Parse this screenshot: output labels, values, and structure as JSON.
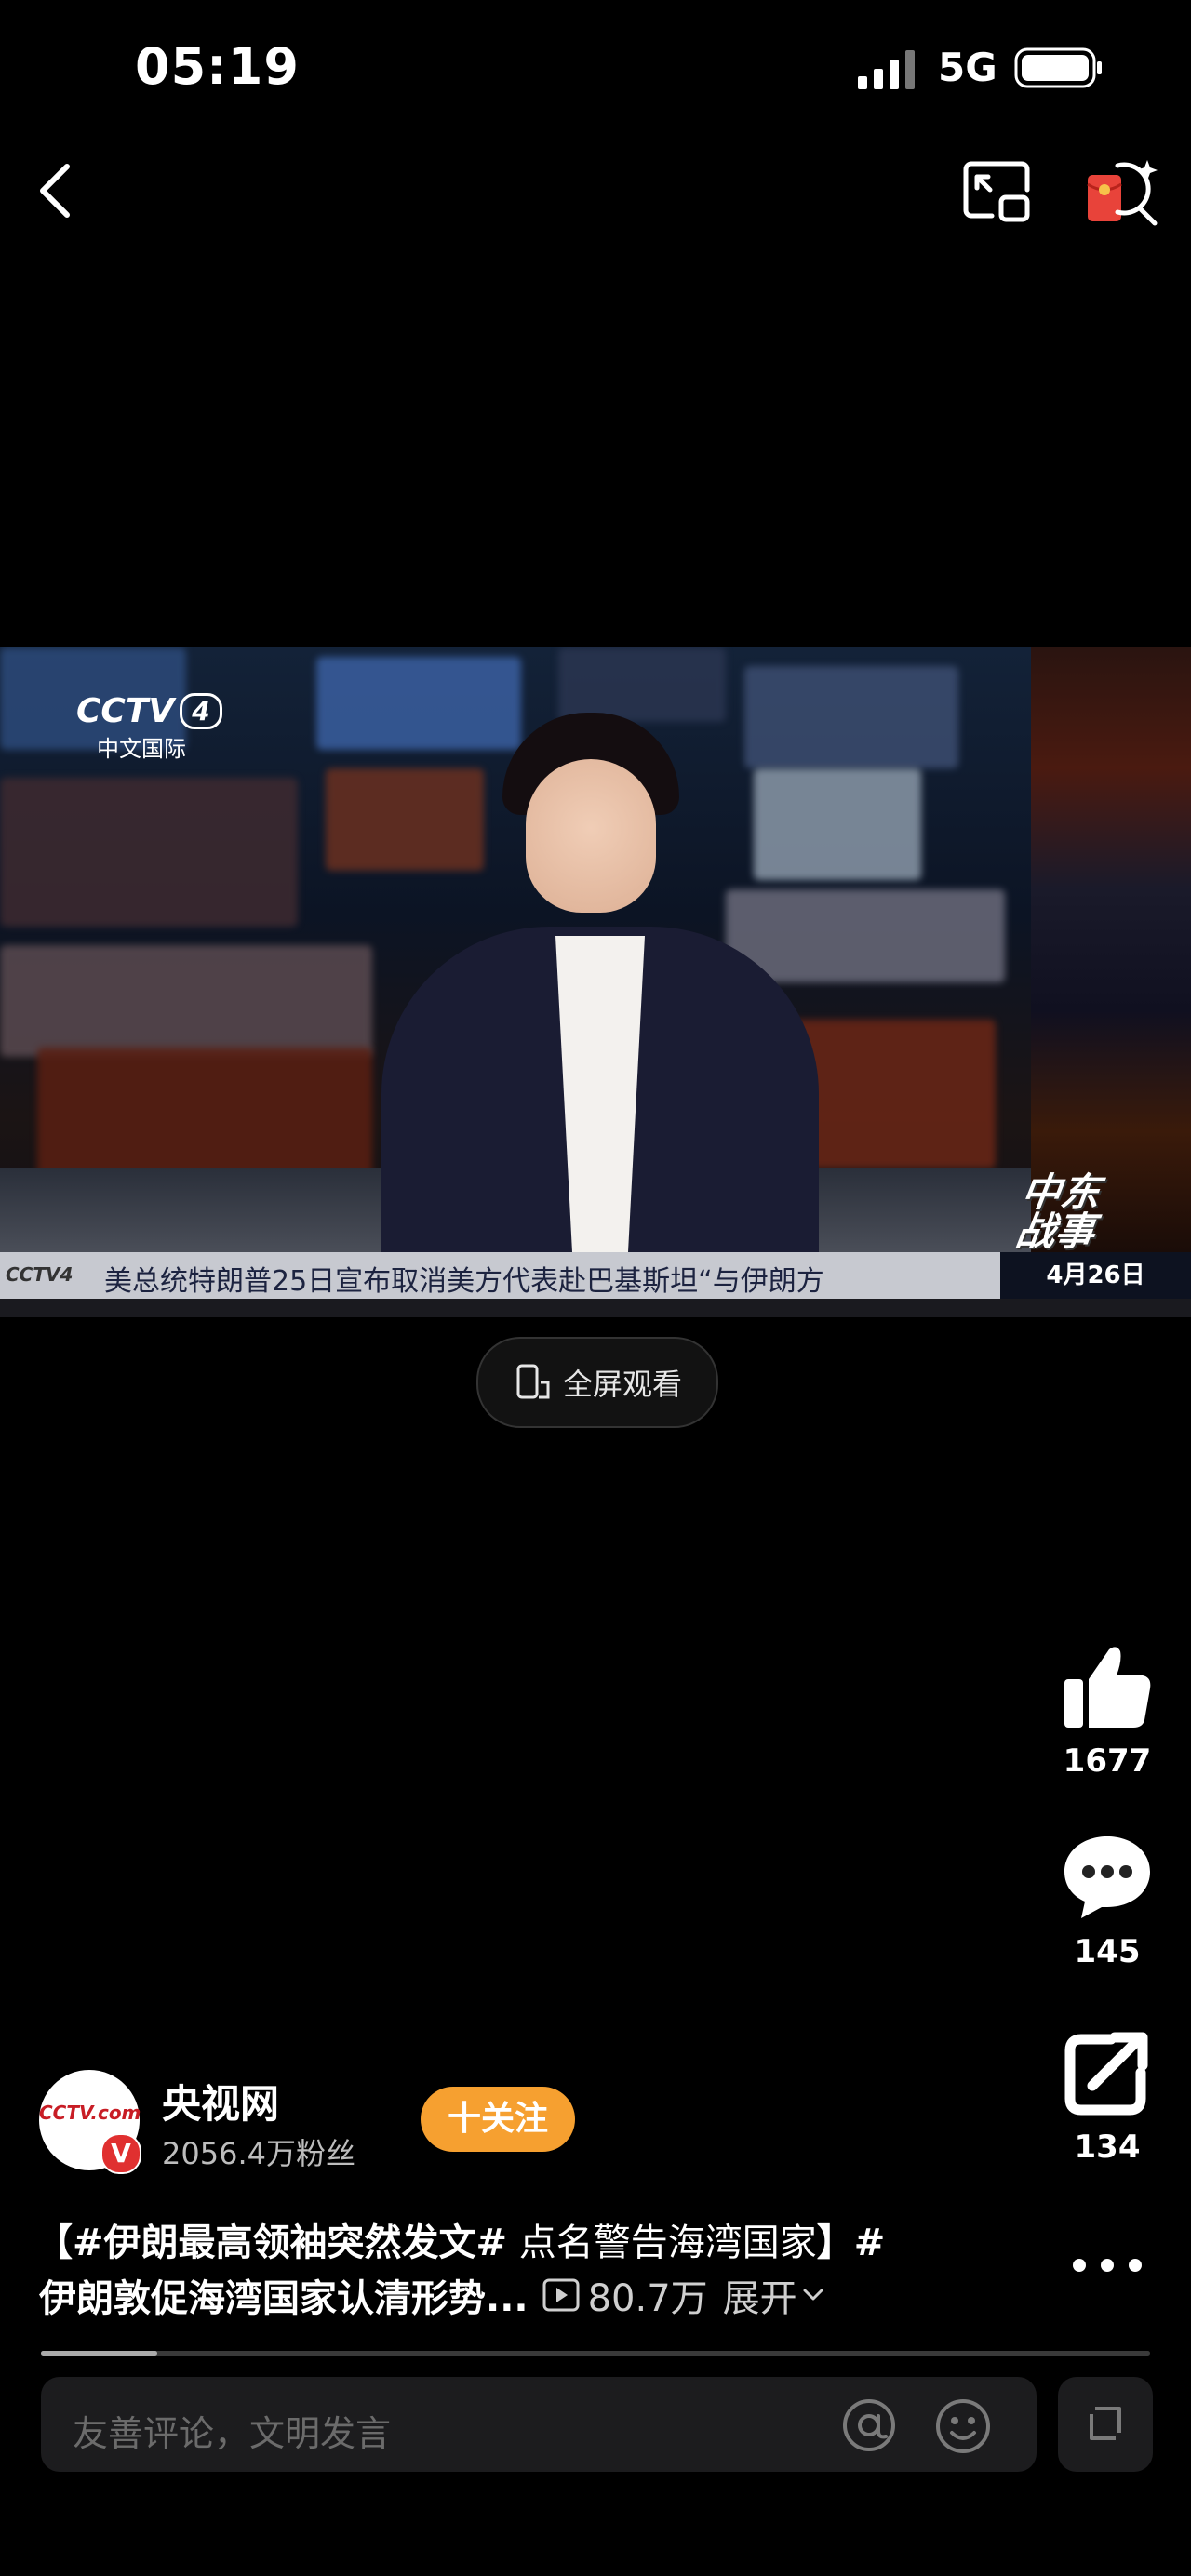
{
  "status_bar": {
    "time": "05:19",
    "network": "5G"
  },
  "video": {
    "channel_logo": "CCTV",
    "channel_number": "4",
    "channel_name": "中文国际",
    "ticker_logo": "CCTV4",
    "ticker_text": "美总统特朗普25日宣布取消美方代表赴巴基斯坦“与伊朗方",
    "program_tag_line1": "中东",
    "program_tag_line2": "战事",
    "date": "4月26日"
  },
  "fullscreen": {
    "label": "全屏观看"
  },
  "actions": {
    "likes": "1677",
    "comments": "145",
    "shares": "134"
  },
  "author": {
    "name": "央视网",
    "fans": "2056.4万粉丝",
    "follow_label": "十关注",
    "avatar_text": "CCTV.com",
    "verify": "V"
  },
  "caption": {
    "line1_tag1": "【#伊朗最高领袖突然发文#",
    "line1_plain": " 点名警告海湾国家",
    "line1_tag2": "】#",
    "line2": "伊朗敦促海湾国家认清形势...",
    "views": "80.7万",
    "expand": "展开"
  },
  "progress": {
    "fraction": 0.105
  },
  "comment_bar": {
    "placeholder": "友善评论，文明发言"
  },
  "colors": {
    "follow": "#f6a030",
    "background": "#000000"
  }
}
